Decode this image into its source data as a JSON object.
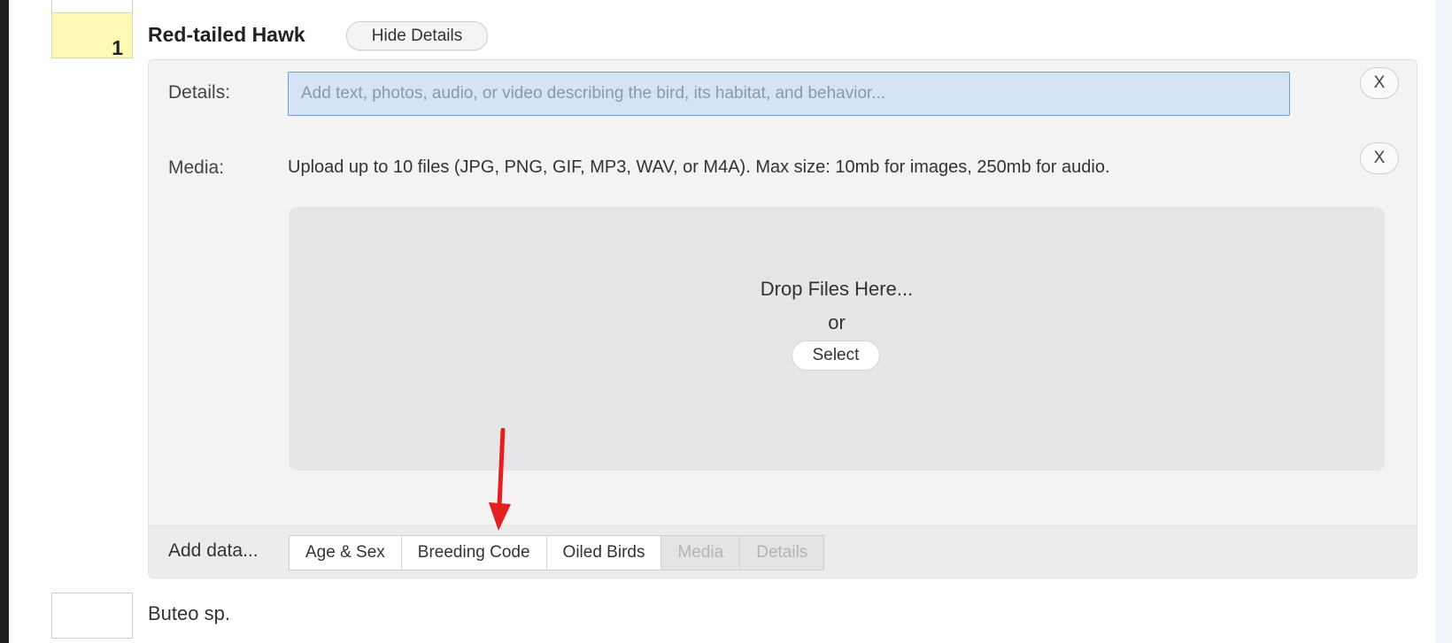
{
  "species_row": {
    "count": "1",
    "name": "Red-tailed Hawk",
    "hide_details_label": "Hide Details"
  },
  "details_panel": {
    "details_label": "Details:",
    "details_placeholder": "Add text, photos, audio, or video describing the bird, its habitat, and behavior...",
    "details_value": "",
    "media_label": "Media:",
    "media_instructions": "Upload up to 10 files (JPG, PNG, GIF, MP3, WAV, or M4A). Max size: 10mb for images, 250mb for audio.",
    "close_label": "X",
    "dropzone": {
      "drop_text": "Drop Files Here...",
      "or_text": "or",
      "select_label": "Select"
    },
    "add_data_label": "Add data...",
    "tabs": [
      {
        "label": "Age & Sex",
        "enabled": true
      },
      {
        "label": "Breeding Code",
        "enabled": true
      },
      {
        "label": "Oiled Birds",
        "enabled": true
      },
      {
        "label": "Media",
        "enabled": false
      },
      {
        "label": "Details",
        "enabled": false
      }
    ]
  },
  "next_row": {
    "count": "",
    "name": "Buteo sp."
  },
  "annotation": {
    "arrow_color": "#e41f1f",
    "arrow_target": "Breeding Code"
  },
  "colors": {
    "count_highlight": "#fdf8b6",
    "input_focus_bg": "#d6e3f7",
    "input_focus_border": "#6d9ee0"
  }
}
